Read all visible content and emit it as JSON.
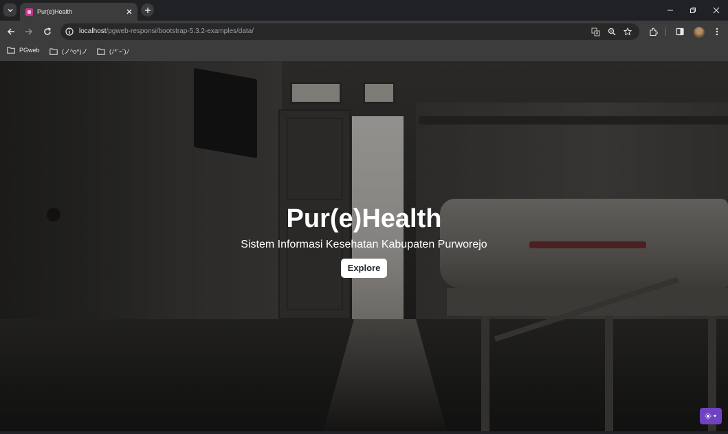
{
  "browser": {
    "tab": {
      "title": "Pur(e)Health",
      "favicon": "page-favicon",
      "accent": "#c2368a"
    },
    "url": {
      "host": "localhost",
      "path": "/pgweb-responsi/bootstrap-5.3.2-examples/data/"
    },
    "icons": [
      "tab-search-icon",
      "close-icon",
      "plus-icon",
      "minimize-icon",
      "restore-icon",
      "close-window-icon",
      "back-icon",
      "forward-icon",
      "reload-icon",
      "info-icon",
      "translate-icon",
      "zoom-icon",
      "star-icon",
      "extensions-icon",
      "side-panel-icon",
      "avatar",
      "menu-icon"
    ]
  },
  "bookmarks": [
    {
      "label": "PGweb"
    },
    {
      "label": "(ノ^o^)ノ"
    },
    {
      "label": "(ﾉ*´ｰ`)ﾉ"
    }
  ],
  "hero": {
    "title": "Pur(e)Health",
    "subtitle": "Sistem Informasi Kesehatan Kabupaten Purworejo",
    "button": "Explore"
  },
  "theme_toggle": {
    "icon": "sun-icon",
    "color": "#6f42c1"
  }
}
